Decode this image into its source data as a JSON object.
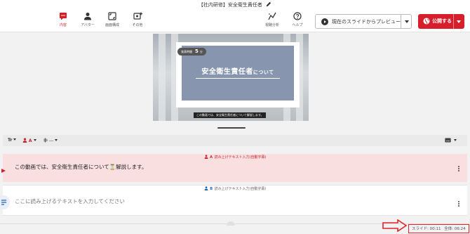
{
  "header": {
    "title": "【社内研修】安全衛生責任者",
    "nav": [
      {
        "label": "内容",
        "icon": "chat-icon",
        "active": true
      },
      {
        "label": "アバター",
        "icon": "person-icon",
        "active": false
      },
      {
        "label": "画面構成",
        "icon": "layout-icon",
        "active": false
      },
      {
        "label": "その他",
        "icon": "settings-plus-icon",
        "active": false
      }
    ],
    "tools": [
      {
        "label": "視聴分析",
        "icon": "analytics-icon"
      },
      {
        "label": "ヘルプ",
        "icon": "help-icon"
      }
    ],
    "preview_label": "現在のスライドからプレビュー",
    "publish_label": "公開する"
  },
  "slide": {
    "badge_prefix": "発表時間",
    "badge_number": "5",
    "badge_suffix": "分",
    "title_main": "安全衛生責任者",
    "title_tail": "について",
    "subtitle": "この動画では、安全衛生責任者について解説します。"
  },
  "toolbar": {
    "text_style": "Tr",
    "speaker": "A",
    "voice": "---"
  },
  "rows": [
    {
      "letter": "A",
      "label": "読み上げテキスト入力(自動字幕)",
      "text": "この動画では、安全衛生責任者について⏳解説します。"
    },
    {
      "letter": "B",
      "label": "読み上げテキスト入力(自動字幕)",
      "placeholder": "ここに読み上げるテキストを入力してください"
    }
  ],
  "status": {
    "slide_label": "スライド:",
    "slide_time": "00:11",
    "total_label": "全体:",
    "total_time": "06:24"
  },
  "colors": {
    "accent": "#d71f2b",
    "row_a_bg": "#f9dfe0",
    "slide_card": "#8796ae",
    "speaker_b": "#1f63b4"
  }
}
